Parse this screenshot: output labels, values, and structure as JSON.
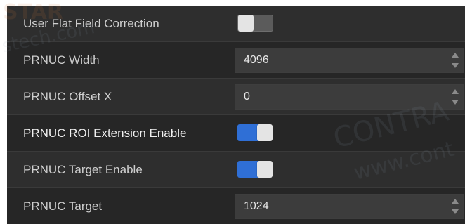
{
  "rows": [
    {
      "label": "User Flat Field Correction",
      "control": "toggle",
      "state": "off"
    },
    {
      "label": "PRNUC Width",
      "control": "spinbox",
      "value": "4096"
    },
    {
      "label": "PRNUC Offset X",
      "control": "spinbox",
      "value": "0"
    },
    {
      "label": "PRNUC ROI Extension Enable",
      "control": "toggle",
      "state": "on"
    },
    {
      "label": "PRNUC Target Enable",
      "control": "toggle",
      "state": "on"
    },
    {
      "label": "PRNUC Target",
      "control": "spinbox",
      "value": "1024"
    }
  ],
  "colors": {
    "toggle_on": "#2f6fd6",
    "toggle_off": "#5b5b5b",
    "panel_bg": "#2b2b2b"
  },
  "watermark": {
    "left_top": "STAR",
    "left_mid": "stech.com",
    "right_big": "CONTRA",
    "right_small": "www.cont"
  }
}
